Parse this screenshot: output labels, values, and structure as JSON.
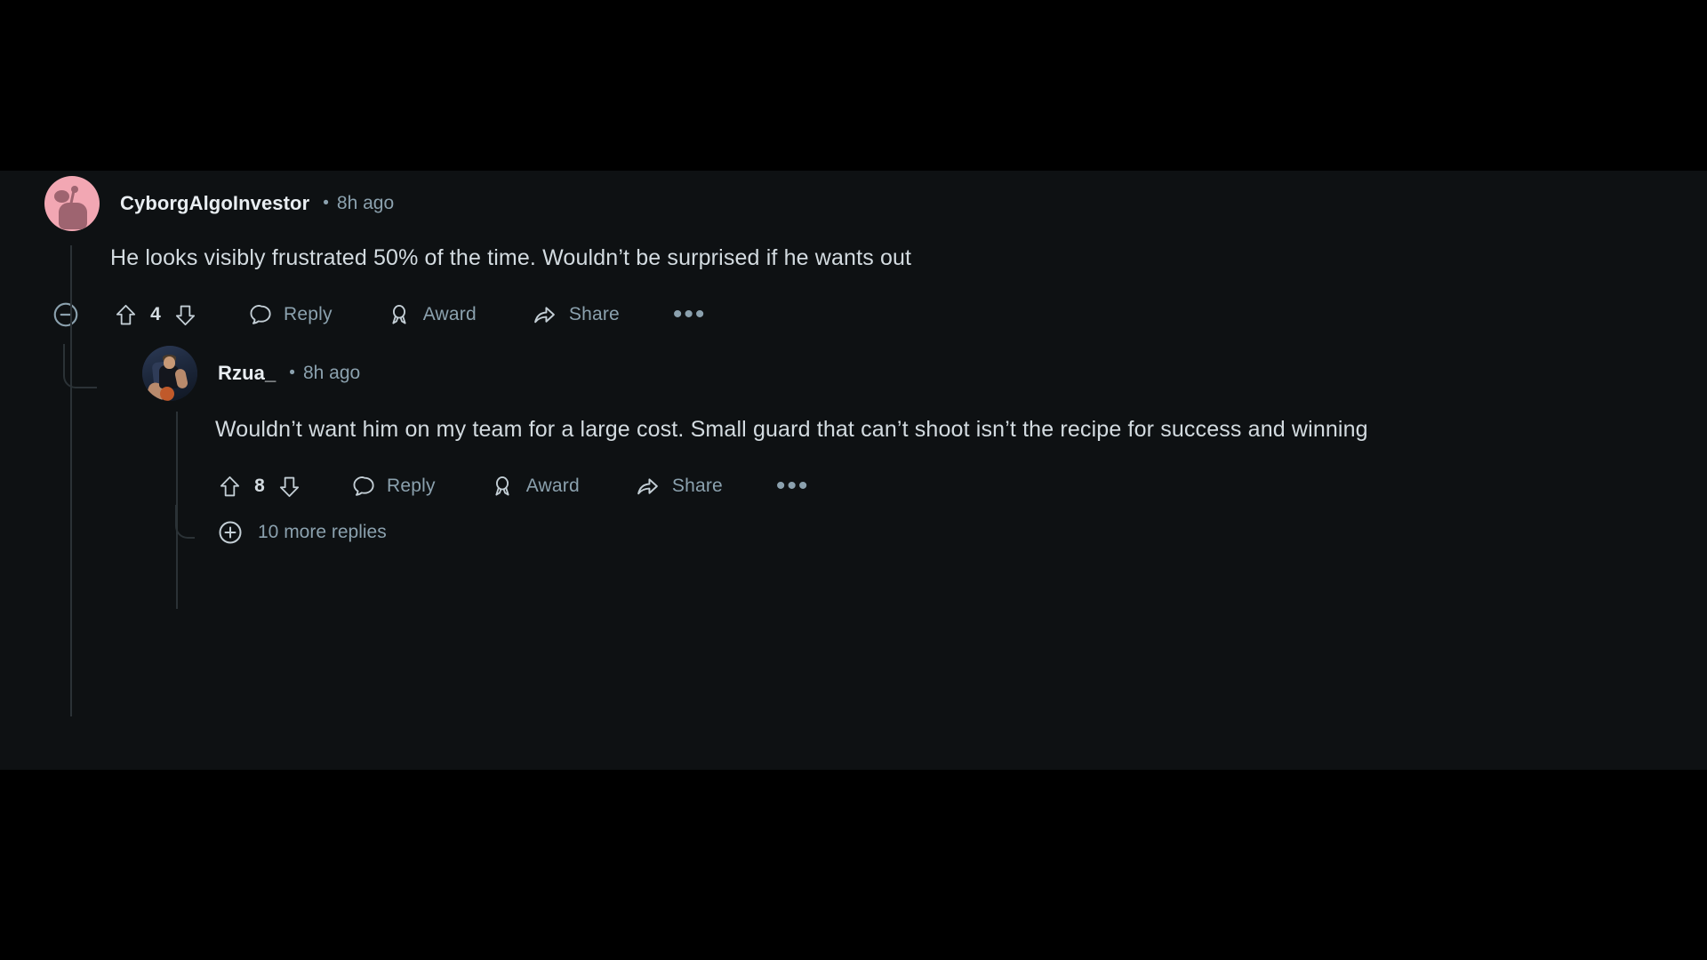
{
  "theme": {
    "page_background": "#000000",
    "content_background": "#0e1113",
    "text_primary": "#d3dbe0",
    "text_author": "#e9eef2",
    "text_muted": "#8ba1ae",
    "thread_line": "#2b3236",
    "avatar_pink": "#f2a7b3"
  },
  "thread": {
    "comment": {
      "avatar_icon": "snoo-avatar-pink",
      "author": "CyborgAlgoInvestor",
      "separator": "•",
      "timestamp": "8h ago",
      "body": "He looks visibly frustrated 50% of the time. Wouldn’t be surprised if he wants out",
      "actions": {
        "collapse_icon": "minus-circle-icon",
        "upvote_icon": "upvote-arrow-icon",
        "vote_count": "4",
        "downvote_icon": "downvote-arrow-icon",
        "reply_icon": "comment-bubble-icon",
        "reply_label": "Reply",
        "award_icon": "award-medal-icon",
        "award_label": "Award",
        "share_icon": "share-arrow-icon",
        "share_label": "Share",
        "more_icon": "ellipsis-icon",
        "more_label": "•••"
      },
      "reply": {
        "avatar_icon": "user-photo-avatar",
        "author": "Rzua_",
        "separator": "•",
        "timestamp": "8h ago",
        "body": "Wouldn’t want him on my team for a large cost. Small guard that can’t shoot isn’t the recipe for success and winning",
        "actions": {
          "upvote_icon": "upvote-arrow-icon",
          "vote_count": "8",
          "downvote_icon": "downvote-arrow-icon",
          "reply_icon": "comment-bubble-icon",
          "reply_label": "Reply",
          "award_icon": "award-medal-icon",
          "award_label": "Award",
          "share_icon": "share-arrow-icon",
          "share_label": "Share",
          "more_icon": "ellipsis-icon",
          "more_label": "•••"
        },
        "more_replies": {
          "icon": "plus-circle-icon",
          "label": "10 more replies"
        }
      }
    }
  }
}
